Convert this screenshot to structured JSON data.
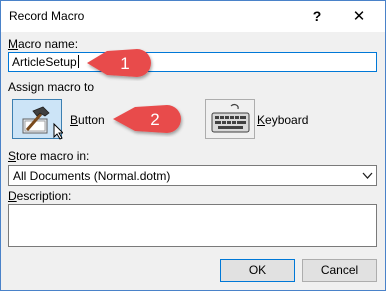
{
  "window": {
    "title": "Record Macro",
    "help_label": "?",
    "close_label": "✕"
  },
  "macro_name": {
    "label_key": "M",
    "label_rest": "acro name:",
    "value": "ArticleSetup"
  },
  "assign": {
    "label": "Assign macro to",
    "button_key": "B",
    "button_rest": "utton",
    "keyboard_key": "K",
    "keyboard_rest": "eyboard"
  },
  "store": {
    "label_key": "S",
    "label_rest": "tore macro in:",
    "selected": "All Documents (Normal.dotm)",
    "arrow_icon": "chevron-down-icon"
  },
  "description": {
    "label_key": "D",
    "label_rest": "escription:",
    "value": ""
  },
  "buttons": {
    "ok": "OK",
    "cancel": "Cancel"
  },
  "callouts": [
    {
      "number": "1",
      "color": "#e84c4c"
    },
    {
      "number": "2",
      "color": "#e84c4c"
    }
  ]
}
